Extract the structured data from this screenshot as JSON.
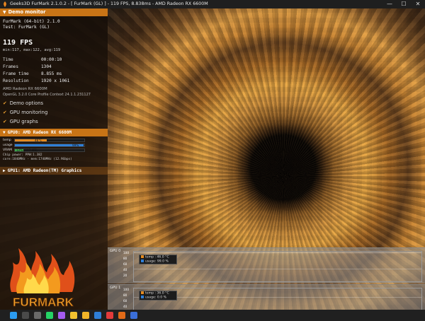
{
  "window": {
    "title": "Geeks3D FurMark 2.1.0.2 - [ FurMark (GL) ] - 119 FPS, 8.838ms - AMD Radeon RX 6600M",
    "controls": [
      "—",
      "☐",
      "✕"
    ]
  },
  "demo_monitor": {
    "header": "Demo monitor",
    "app_name": "FurMark (64-bit) 2.1.0",
    "test_name": "Test: FurMark (GL)",
    "fps": "119 FPS",
    "fps_stats": "min:117, max:122, avg:119",
    "stats": [
      {
        "label": "Time",
        "value": "00:00:10"
      },
      {
        "label": "Frames",
        "value": "1304"
      },
      {
        "label": "Frame time",
        "value": "8.855 ms"
      },
      {
        "label": "Resolution",
        "value": "1920 x 1061"
      }
    ],
    "gpu_name": "AMD Radeon RX 6600M",
    "opengl_info": "OpenGL 3.2.0 Core Profile Context 24.1.1.231127",
    "options": [
      {
        "label": "Demo options",
        "checked": true
      },
      {
        "label": "GPU monitoring",
        "checked": true
      },
      {
        "label": "GPU graphs",
        "checked": true
      }
    ]
  },
  "gpu0": {
    "header": "GPU0: AMD Radeon RX 6600M",
    "bars": [
      {
        "label": "temp",
        "value_text": "46°C",
        "level": 0.46,
        "color": "#e38a20"
      },
      {
        "label": "usage",
        "value_text": "99%",
        "level": 0.99,
        "color": "#2f7fd8"
      },
      {
        "label": "VRAM",
        "value_text": "12% (997 MB)",
        "level": 0.12,
        "color": "#3fa84a"
      }
    ],
    "chip_power": "Chip power: PPW:1.382",
    "clocks": "core:1840MHz - mem:1740MHz (12.9Gbps)"
  },
  "gpu1": {
    "header": "GPU1: AMD Radeon(TM) Graphics"
  },
  "logo": {
    "text": "FURMARK"
  },
  "graphs": [
    {
      "name": "GPU 0",
      "ticks": [
        "100",
        "80",
        "60",
        "40",
        "20"
      ],
      "legend": [
        {
          "label": "temp : 46.0 °C",
          "color": "#e38a20"
        },
        {
          "label": "usage: 99.0 %",
          "color": "#2f7fd8"
        }
      ]
    },
    {
      "name": "GPU 1",
      "ticks": [
        "100",
        "80",
        "60",
        "40"
      ],
      "legend": [
        {
          "label": "temp : 36.0 °C",
          "color": "#e38a20"
        },
        {
          "label": "usage: 0.0 %",
          "color": "#2f7fd8"
        }
      ]
    }
  ],
  "taskbar": {
    "icons": [
      {
        "name": "windows-start-icon",
        "color": "#2b9cf2"
      },
      {
        "name": "search-icon",
        "color": "#4a4a4a"
      },
      {
        "name": "task-view-icon",
        "color": "#6a6a6a"
      },
      {
        "name": "whatsapp-icon",
        "color": "#25d366"
      },
      {
        "name": "messenger-icon",
        "color": "#a45cf0"
      },
      {
        "name": "chrome-icon",
        "color": "#f2c230"
      },
      {
        "name": "file-explorer-icon",
        "color": "#f0b429"
      },
      {
        "name": "app-icon",
        "color": "#2f7fd8"
      },
      {
        "name": "music-app-icon",
        "color": "#e23b3b"
      },
      {
        "name": "furmark-taskbar-icon",
        "color": "#e06a18"
      },
      {
        "name": "app-icon-2",
        "color": "#3b6fd8"
      }
    ]
  }
}
